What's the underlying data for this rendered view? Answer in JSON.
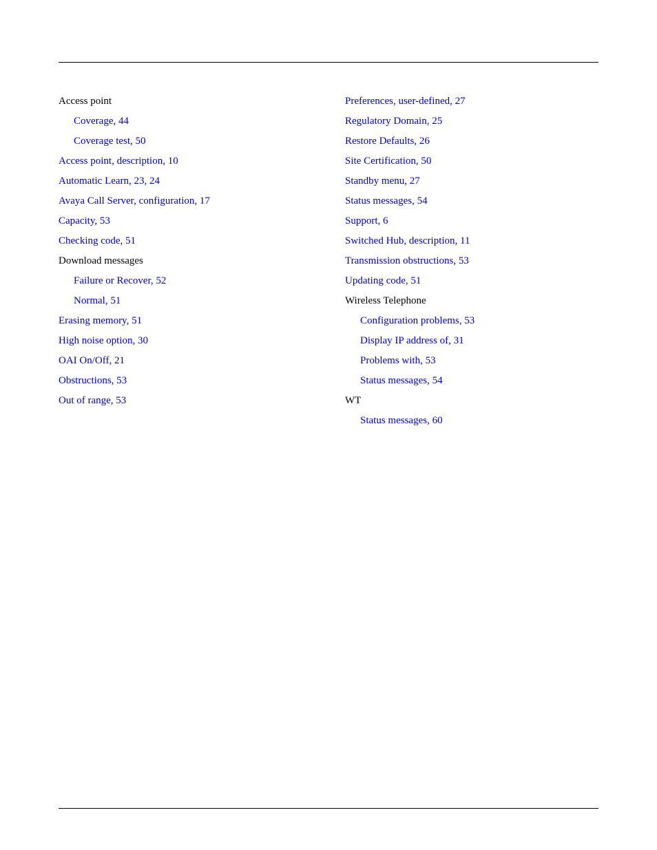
{
  "left_column": [
    {
      "text": "Access point",
      "link": false,
      "indent": 0
    },
    {
      "text": "Coverage, 44",
      "link": true,
      "indent": 1
    },
    {
      "text": "Coverage test, 50",
      "link": true,
      "indent": 1
    },
    {
      "text": "Access point, description, 10",
      "link": true,
      "indent": 0
    },
    {
      "text": "Automatic Learn, 23, 24",
      "link": true,
      "indent": 0
    },
    {
      "text": "Avaya Call Server, configuration, 17",
      "link": true,
      "indent": 0
    },
    {
      "text": "Capacity, 53",
      "link": true,
      "indent": 0
    },
    {
      "text": "Checking code, 51",
      "link": true,
      "indent": 0
    },
    {
      "text": "Download messages",
      "link": false,
      "indent": 0
    },
    {
      "text": "Failure or Recover, 52",
      "link": true,
      "indent": 1
    },
    {
      "text": "Normal, 51",
      "link": true,
      "indent": 1
    },
    {
      "text": "Erasing memory, 51",
      "link": true,
      "indent": 0
    },
    {
      "text": "High noise option, 30",
      "link": true,
      "indent": 0
    },
    {
      "text": "OAI On/Off, 21",
      "link": true,
      "indent": 0
    },
    {
      "text": "Obstructions, 53",
      "link": true,
      "indent": 0
    },
    {
      "text": "Out of range, 53",
      "link": true,
      "indent": 0
    }
  ],
  "right_column": [
    {
      "text": "Preferences, user-defined, 27",
      "link": true,
      "indent": 0
    },
    {
      "text": "Regulatory Domain, 25",
      "link": true,
      "indent": 0
    },
    {
      "text": "Restore Defaults, 26",
      "link": true,
      "indent": 0
    },
    {
      "text": "Site Certification, 50",
      "link": true,
      "indent": 0
    },
    {
      "text": "Standby menu, 27",
      "link": true,
      "indent": 0
    },
    {
      "text": "Status messages, 54",
      "link": true,
      "indent": 0
    },
    {
      "text": "Support, 6",
      "link": true,
      "indent": 0
    },
    {
      "text": "Switched Hub, description, 11",
      "link": true,
      "indent": 0
    },
    {
      "text": "Transmission obstructions, 53",
      "link": true,
      "indent": 0
    },
    {
      "text": "Updating code, 51",
      "link": true,
      "indent": 0
    },
    {
      "text": "Wireless Telephone",
      "link": false,
      "indent": 0
    },
    {
      "text": "Configuration problems, 53",
      "link": true,
      "indent": 1
    },
    {
      "text": "Display IP address of, 31",
      "link": true,
      "indent": 1
    },
    {
      "text": "Problems with, 53",
      "link": true,
      "indent": 1
    },
    {
      "text": "Status messages, 54",
      "link": true,
      "indent": 1
    },
    {
      "text": "WT",
      "link": false,
      "indent": 0
    },
    {
      "text": "Status messages, 60",
      "link": true,
      "indent": 1
    }
  ]
}
